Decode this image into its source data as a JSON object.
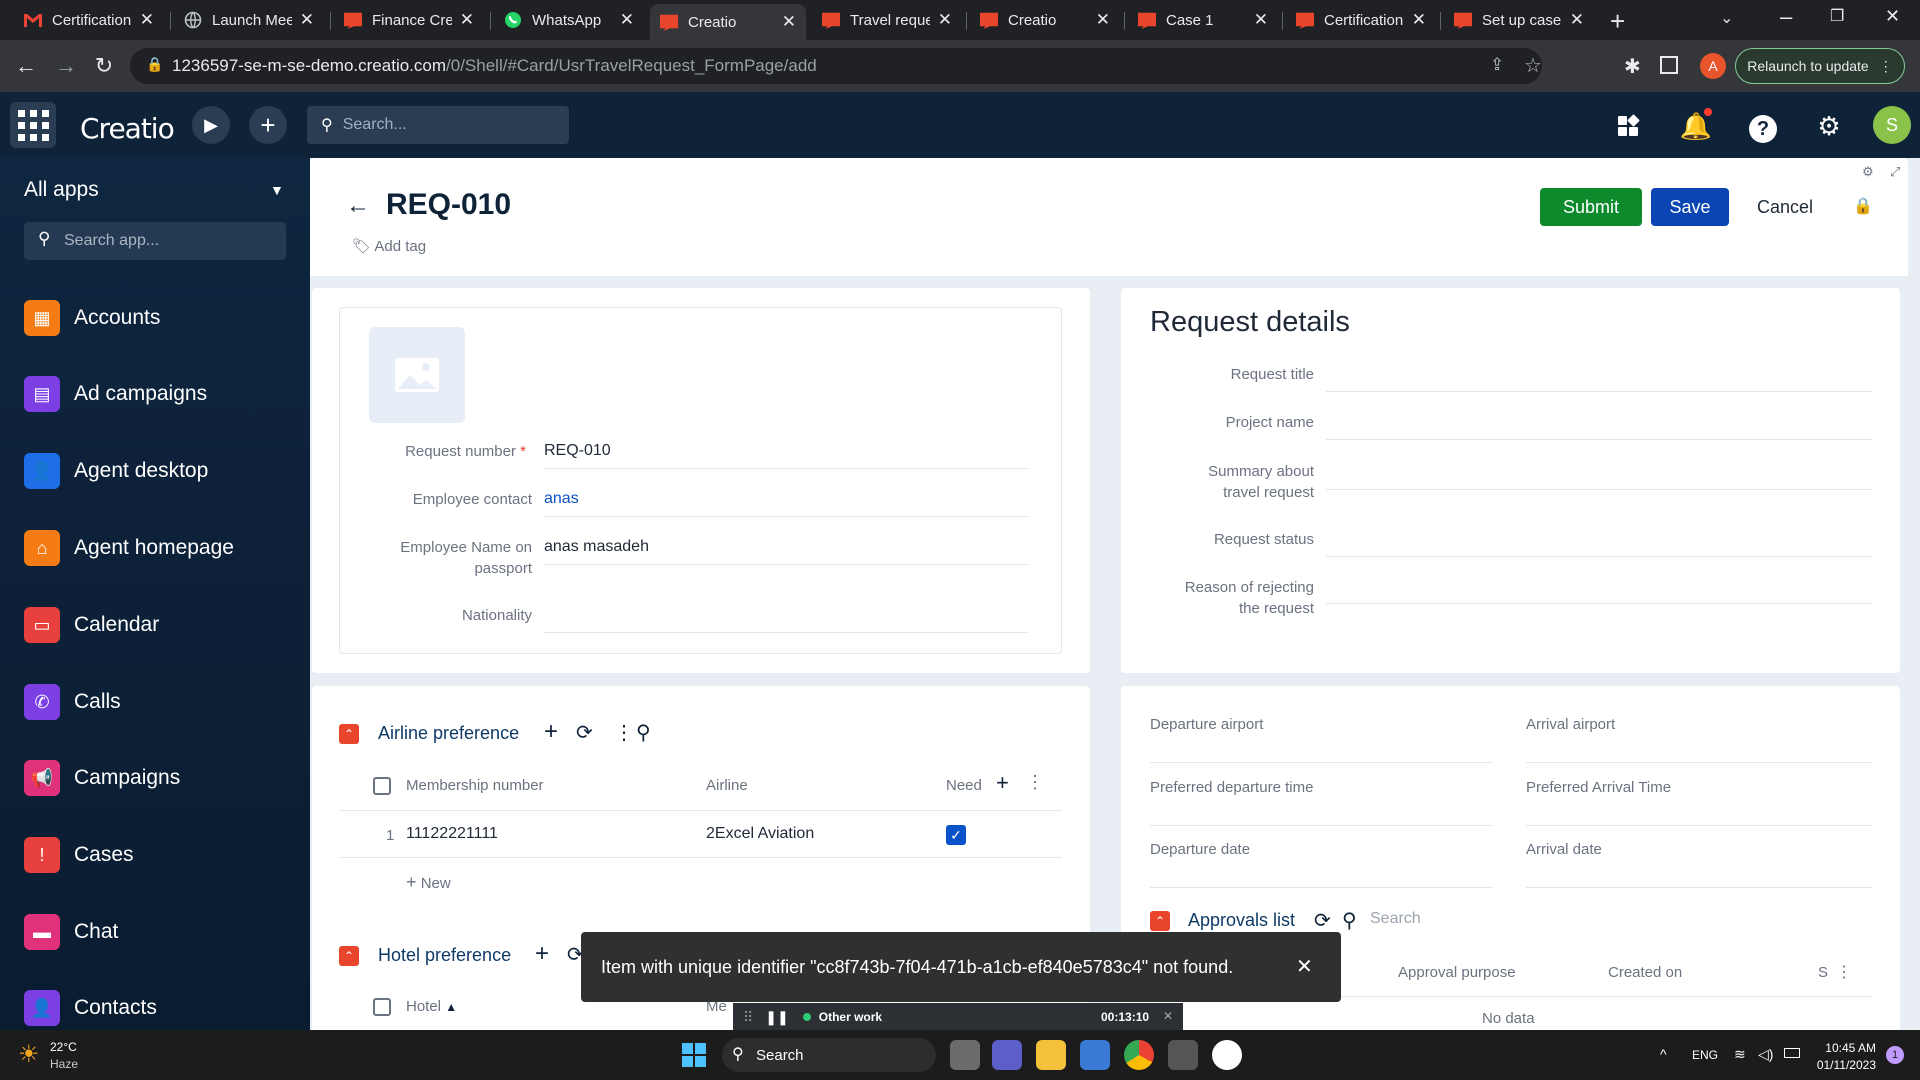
{
  "browser": {
    "tabs": [
      {
        "label": "Certification",
        "icon": "gmail-icon"
      },
      {
        "label": "Launch Mee",
        "icon": "globe-icon"
      },
      {
        "label": "Finance Cre",
        "icon": "creatio-icon"
      },
      {
        "label": "WhatsApp",
        "icon": "whatsapp-icon"
      },
      {
        "label": "Creatio",
        "icon": "creatio-icon"
      },
      {
        "label": "Travel reque",
        "icon": "creatio-icon"
      },
      {
        "label": "Creatio",
        "icon": "creatio-icon"
      },
      {
        "label": "Case 1",
        "icon": "creatio-icon"
      },
      {
        "label": "Certification",
        "icon": "creatio-icon"
      },
      {
        "label": "Set up case",
        "icon": "creatio-icon"
      }
    ],
    "url_domain": "1236597-se-m-se-demo.creatio.com",
    "url_path": "/0/Shell/#Card/UsrTravelRequest_FormPage/add",
    "profile_initial": "A",
    "relaunch_label": "Relaunch to update"
  },
  "app": {
    "logo": "Creatio",
    "search_placeholder": "Search...",
    "user_initial": "S"
  },
  "sidebar": {
    "title": "All apps",
    "search_placeholder": "Search app...",
    "items": [
      {
        "label": "Accounts",
        "color": "#f57c14"
      },
      {
        "label": "Ad campaigns",
        "color": "#7b3fe4"
      },
      {
        "label": "Agent desktop",
        "color": "#1e6ee8"
      },
      {
        "label": "Agent homepage",
        "color": "#f57c14"
      },
      {
        "label": "Calendar",
        "color": "#e8403c"
      },
      {
        "label": "Calls",
        "color": "#7b3fe4"
      },
      {
        "label": "Campaigns",
        "color": "#e0327a"
      },
      {
        "label": "Cases",
        "color": "#e8403c"
      },
      {
        "label": "Chat",
        "color": "#e0327a"
      },
      {
        "label": "Contacts",
        "color": "#7b3fe4"
      }
    ]
  },
  "page": {
    "title": "REQ-010",
    "add_tag": "Add tag",
    "submit": "Submit",
    "save": "Save",
    "cancel": "Cancel"
  },
  "form": {
    "request_number_label": "Request number",
    "request_number": "REQ-010",
    "employee_contact_label": "Employee contact",
    "employee_contact": "anas",
    "employee_name_label_1": "Employee Name on",
    "employee_name_label_2": "passport",
    "employee_name": "anas masadeh",
    "nationality_label": "Nationality"
  },
  "details": {
    "title": "Request details",
    "request_title": "Request title",
    "project_name": "Project name",
    "summary_1": "Summary about",
    "summary_2": "travel request",
    "status": "Request status",
    "reason_1": "Reason of rejecting",
    "reason_2": "the request"
  },
  "airline": {
    "title": "Airline preference",
    "col_membership": "Membership number",
    "col_airline": "Airline",
    "col_need": "Need",
    "rows": [
      {
        "index": "1",
        "membership": "11122221111",
        "airline": "2Excel Aviation",
        "need": true
      }
    ],
    "new_label": "New"
  },
  "hotel": {
    "title": "Hotel preference",
    "col_hotel": "Hotel",
    "col_partial": "Me"
  },
  "travel": {
    "departure_airport": "Departure airport",
    "arrival_airport": "Arrival airport",
    "pref_departure": "Preferred departure time",
    "pref_arrival": "Preferred Arrival Time",
    "departure_date": "Departure date",
    "arrival_date": "Arrival date"
  },
  "approvals": {
    "title": "Approvals list",
    "search": "Search",
    "col_purpose": "Approval purpose",
    "col_created": "Created on",
    "col_s": "S",
    "empty": "No data"
  },
  "toast": {
    "message": "Item with unique identifier \"cc8f743b-7f04-471b-a1cb-ef840e5783c4\" not found."
  },
  "timer": {
    "label": "Other work",
    "time": "00:13:10"
  },
  "taskbar": {
    "weather_temp": "22°C",
    "weather_desc": "Haze",
    "search": "Search",
    "lang": "ENG",
    "time": "10:45 AM",
    "date": "01/11/2023",
    "notif_count": "1"
  }
}
